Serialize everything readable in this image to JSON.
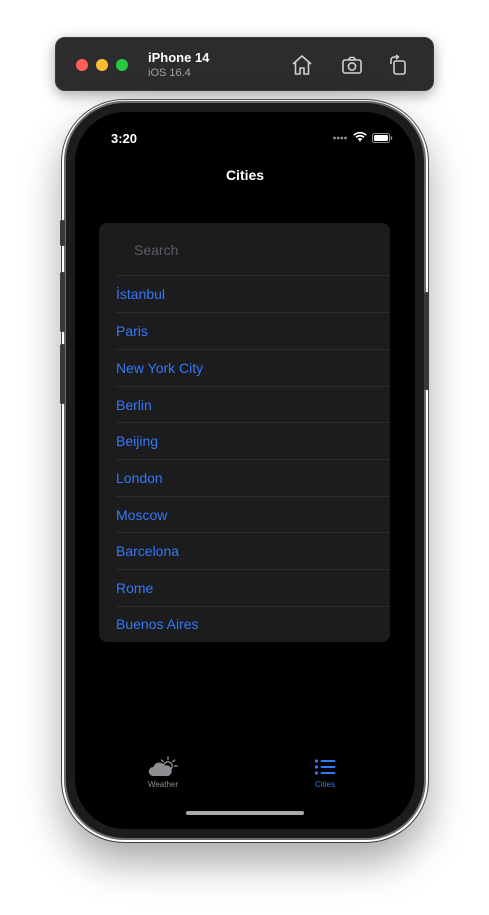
{
  "simulator": {
    "device_name": "iPhone 14",
    "os_version": "iOS 16.4",
    "controls": [
      "home-icon",
      "screenshot-icon",
      "rotate-icon"
    ]
  },
  "status_bar": {
    "time": "3:20"
  },
  "navigation": {
    "title": "Cities"
  },
  "search": {
    "placeholder": "Search",
    "value": ""
  },
  "cities": [
    "İstanbul",
    "Paris",
    "New York City",
    "Berlin",
    "Beijing",
    "London",
    "Moscow",
    "Barcelona",
    "Rome",
    "Buenos Aires"
  ],
  "tab_bar": {
    "tabs": [
      {
        "label": "Weather",
        "icon": "cloud-sun-icon",
        "selected": false
      },
      {
        "label": "Cities",
        "icon": "list-icon",
        "selected": true
      }
    ]
  },
  "colors": {
    "accent": "#3478f6",
    "screen_background": "#000000",
    "card_background": "#1c1c1e",
    "separator": "#2c2c2e",
    "inactive_tab": "#8e8e93"
  }
}
